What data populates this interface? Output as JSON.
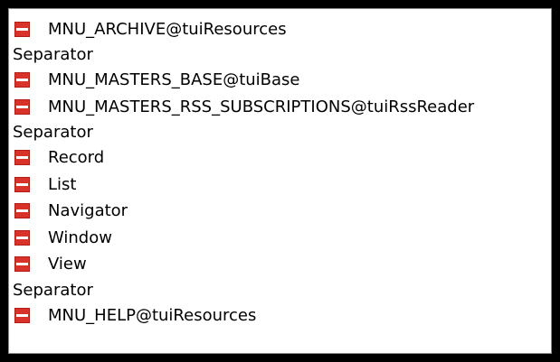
{
  "menu_tree": {
    "items": [
      {
        "type": "menu",
        "label": "MNU_ARCHIVE@tuiResources",
        "icon": "menu-icon"
      },
      {
        "type": "separator",
        "label": "Separator"
      },
      {
        "type": "menu",
        "label": "MNU_MASTERS_BASE@tuiBase",
        "icon": "menu-icon"
      },
      {
        "type": "menu",
        "label": "MNU_MASTERS_RSS_SUBSCRIPTIONS@tuiRssReader",
        "icon": "menu-icon"
      },
      {
        "type": "separator",
        "label": "Separator"
      },
      {
        "type": "menu",
        "label": "Record",
        "icon": "menu-icon"
      },
      {
        "type": "menu",
        "label": "List",
        "icon": "menu-icon"
      },
      {
        "type": "menu",
        "label": "Navigator",
        "icon": "menu-icon"
      },
      {
        "type": "menu",
        "label": "Window",
        "icon": "menu-icon"
      },
      {
        "type": "menu",
        "label": "View",
        "icon": "menu-icon"
      },
      {
        "type": "separator",
        "label": "Separator"
      },
      {
        "type": "menu",
        "label": "MNU_HELP@tuiResources",
        "icon": "menu-icon"
      }
    ]
  },
  "colors": {
    "icon_red": "#d9322a",
    "icon_frame": "#b01e18",
    "icon_bar": "#ffffff",
    "background": "#ffffff",
    "outer": "#000000"
  }
}
